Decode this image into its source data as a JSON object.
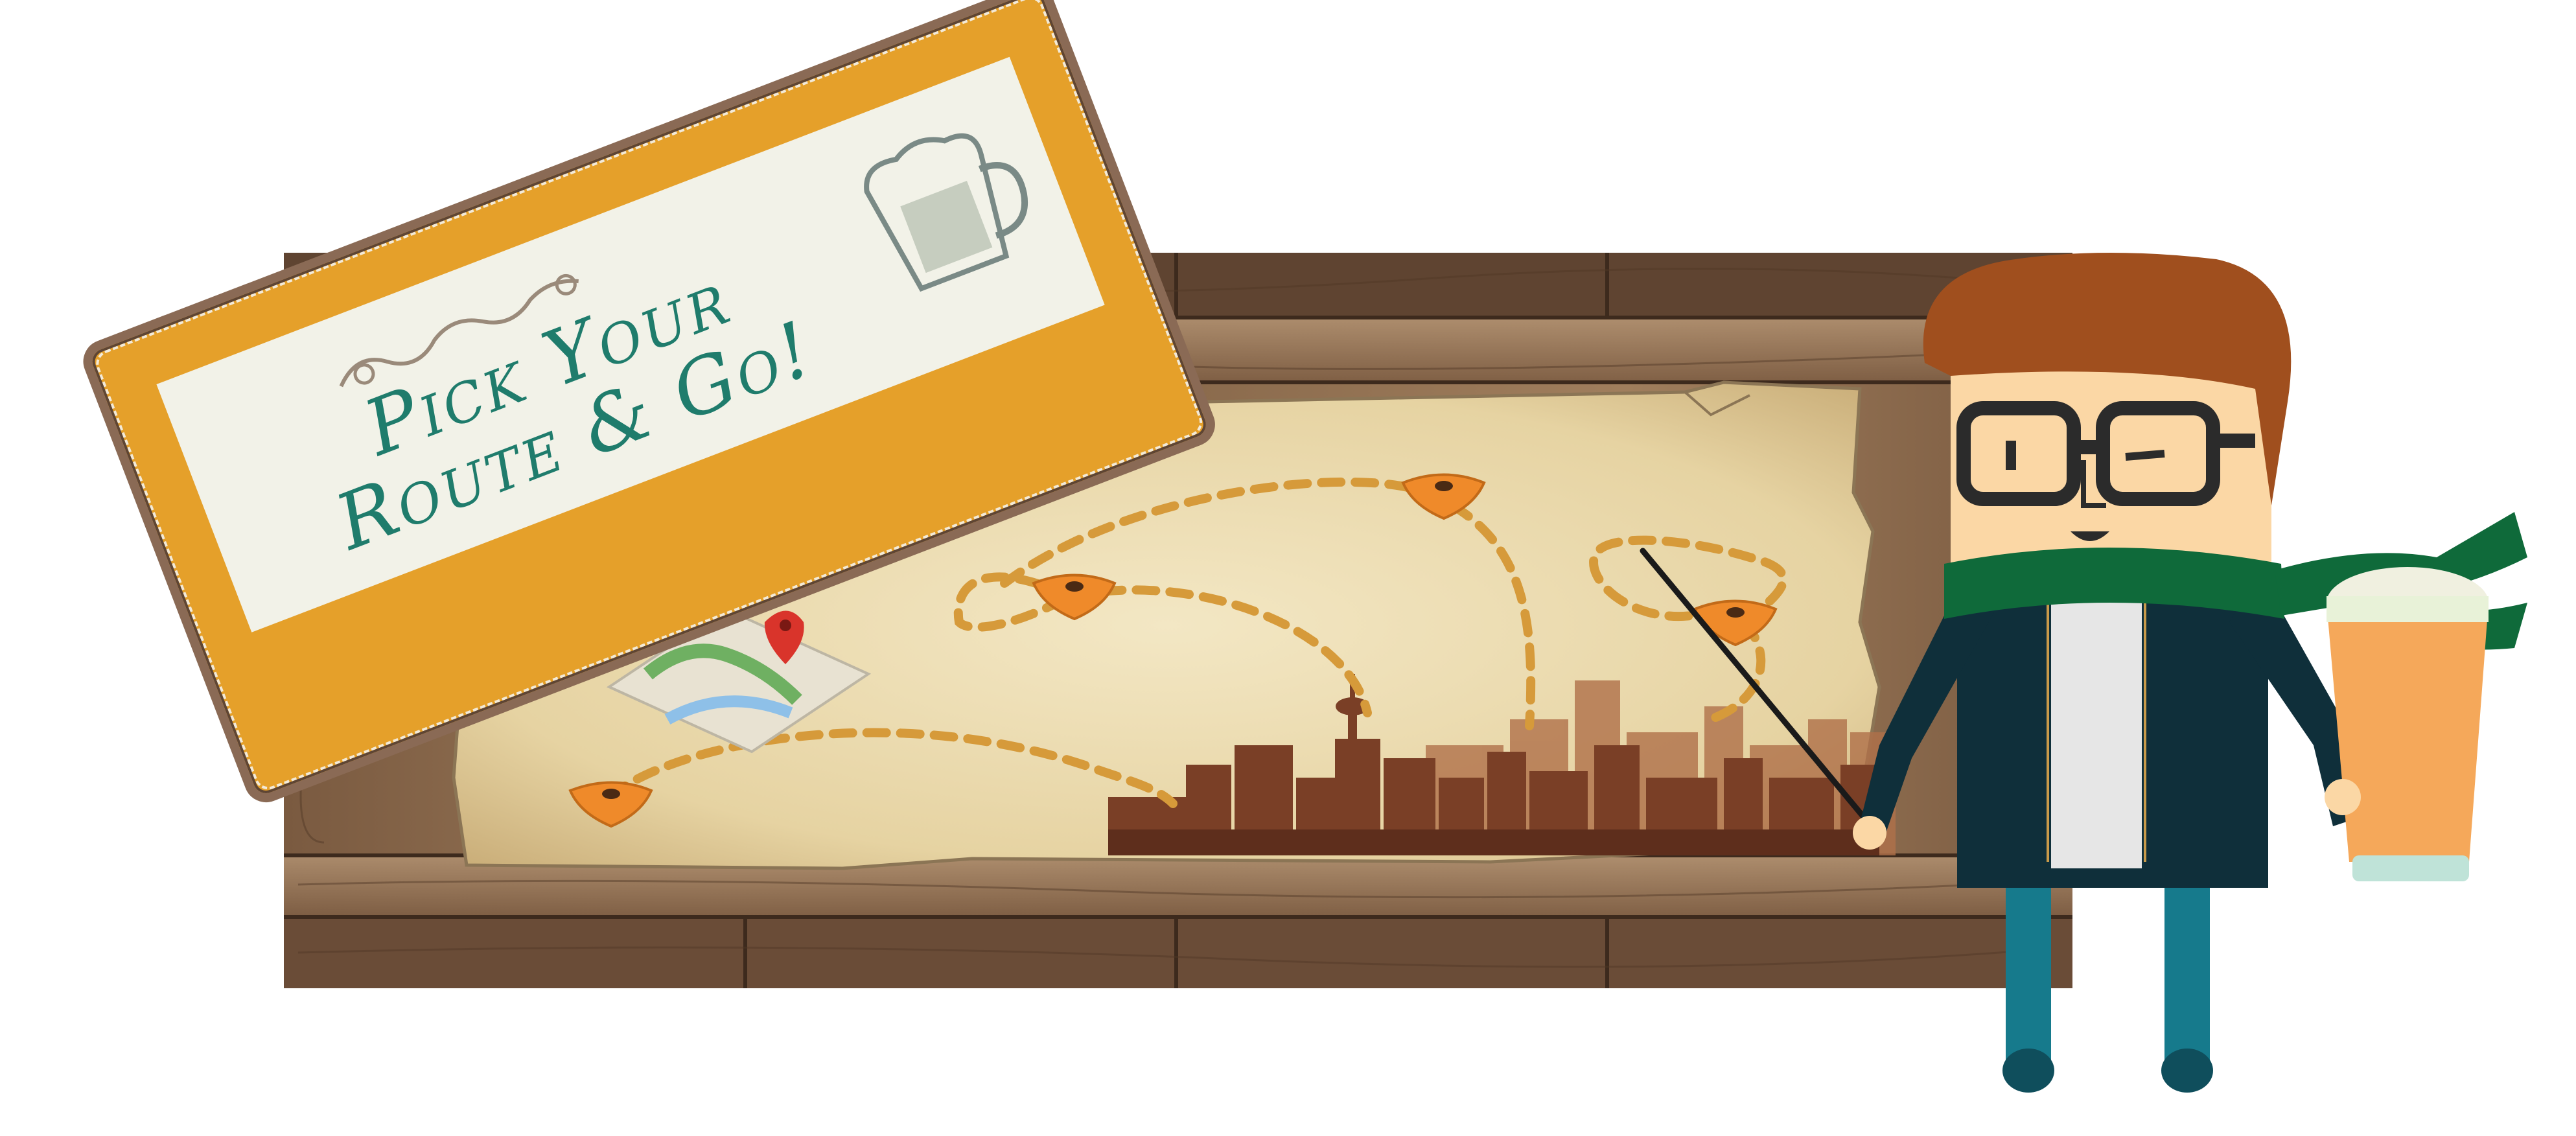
{
  "banner": {
    "title": "Pick Your Route & Go!"
  },
  "colors": {
    "wood": "#8b6a4c",
    "wood_dark": "#5a4030",
    "parchment": "#e9d9ae",
    "route_dash": "#d69a3a",
    "pin": "#ef8a2a",
    "banner_orange": "#e5a02a",
    "banner_text": "#1f7c6c",
    "skyline_dark": "#6b3a26",
    "skyline_light": "#a8623e",
    "hair": "#a04f1e",
    "skin": "#fbd7a5",
    "jacket": "#0f2f3a",
    "scarf": "#0f6a3a",
    "pants": "#167a8c",
    "beer": "#f5a85a"
  },
  "icons": [
    "beer-mug-icon",
    "map-pin-icon",
    "folded-map-icon",
    "flourish-icon"
  ]
}
